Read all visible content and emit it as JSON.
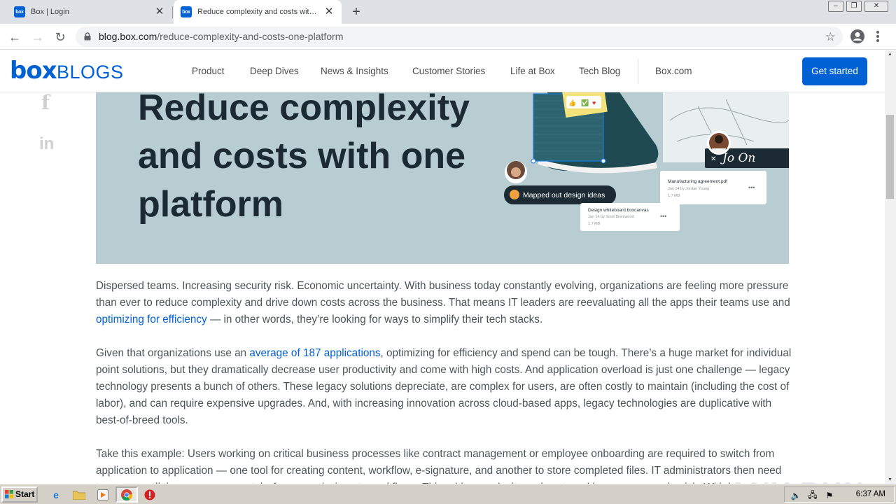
{
  "browser": {
    "tabs": [
      {
        "favicon": "box",
        "title": "Box | Login"
      },
      {
        "favicon": "box",
        "title": "Reduce complexity and costs with one platform"
      }
    ],
    "new_tab": "+",
    "close_glyph": "✕",
    "url_host": "blog.box.com",
    "url_path": "/reduce-complexity-and-costs-one-platform"
  },
  "site": {
    "logo_box": "box",
    "logo_blogs": "BLOGS",
    "nav": [
      "Product",
      "Deep Dives",
      "News & Insights",
      "Customer Stories",
      "Life at Box",
      "Tech Blog"
    ],
    "boxcom": "Box.com",
    "cta": "Get started"
  },
  "social": {
    "facebook": "f",
    "linkedin": "in"
  },
  "hero": {
    "title": "Reduce complexity and costs with one platform",
    "art": {
      "chip": "Mapped out design ideas",
      "file1_name": "Manufacturing agreement.pdf",
      "file1_meta": "Jan 14 by Jordan Young",
      "file1_size": "1.7 MB",
      "file2_name": "Design whiteboard.boxcanvas",
      "file2_meta": "Jan 14 by Scott Brentwood",
      "file2_size": "1.7 MB",
      "signature": "Jo On"
    }
  },
  "article": {
    "p1_a": "Dispersed teams. Increasing security risk. Economic uncertainty. With business today constantly evolving, organizations are feeling more pressure than ever to reduce complexity and drive down costs across the business. That means IT leaders are reevaluating all the apps their teams use and ",
    "p1_link": "optimizing for efficiency",
    "p1_b": " — in other words, they’re looking for ways to simplify their tech stacks.",
    "p2_a": "Given that organizations use an ",
    "p2_link": "average of 187 applications",
    "p2_b": ", optimizing for efficiency and spend can be tough. There’s a huge market for individual point solutions, but they dramatically decrease user productivity and come with high costs. And application overload is just one challenge — legacy technology presents a bunch of others. These legacy solutions depreciate, are complex for users, are often costly to maintain (including the cost of labor), and can require expensive upgrades. And, with increasing innovation across cloud-based apps, legacy technologies are duplicative with best-of-breed tools.",
    "p3": "Take this example: Users working on critical business processes like contract management or employee onboarding are required to switch from application to application — one tool for creating content, workflow, e-signature, and another to store completed files. IT administrators then need to manage all these apps separately, from permissions to workflows. This adds complexity and cost, and increases security risk. With legacy"
  },
  "watermark": "ANY RUN",
  "taskbar": {
    "start": "Start",
    "clock": "6:37 AM"
  },
  "colors": {
    "brand": "#0061d5",
    "hero_bg": "#b8cdd2",
    "body_text": "#4b5558"
  }
}
